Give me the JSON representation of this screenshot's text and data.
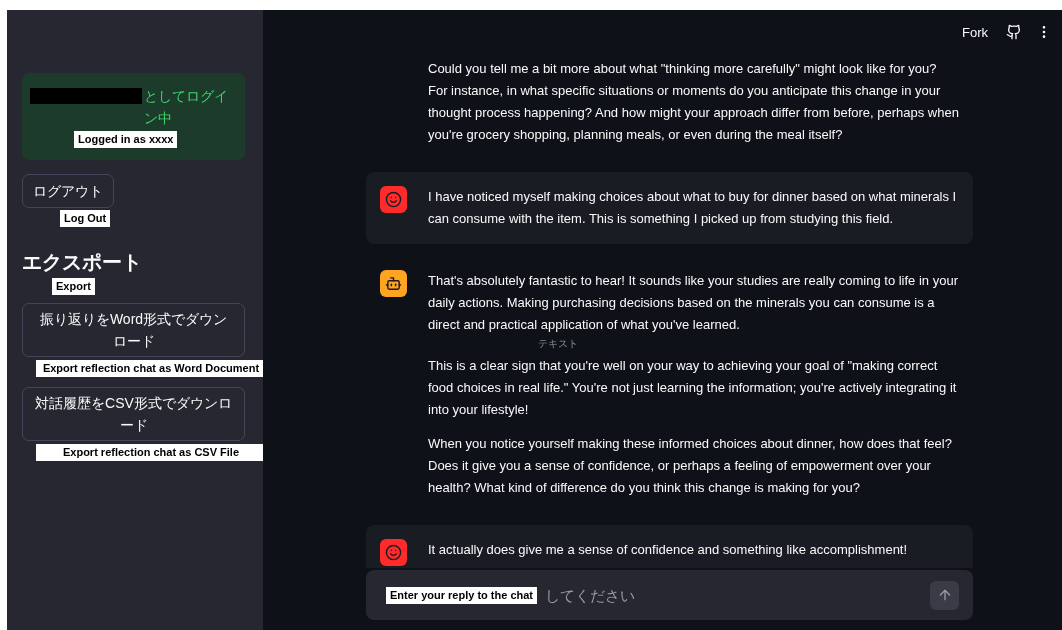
{
  "sidebar": {
    "login_status": {
      "text": "としてログイン中",
      "annotation": "Logged in as xxxx"
    },
    "logout_button": {
      "text": "ログアウト",
      "annotation": "Log Out"
    },
    "export_heading": {
      "text": "エクスポート",
      "annotation": "Export"
    },
    "export_buttons": [
      {
        "text": "振り返りをWord形式でダウンロード",
        "annotation": "Export reflection chat as Word Document"
      },
      {
        "text": "対話履歴をCSV形式でダウンロード",
        "annotation": "Export reflection chat as CSV File"
      }
    ]
  },
  "header": {
    "fork_label": "Fork"
  },
  "messages": [
    {
      "kind": "assistant",
      "avatar_visible": false,
      "paragraphs": [
        "Could you tell me a bit more about what \"thinking more carefully\" might look like for you? For instance, in what specific situations or moments do you anticipate this change in your thought process happening? And how might your approach differ from before, perhaps when you're grocery shopping, planning meals, or even during the meal itself?"
      ]
    },
    {
      "kind": "user",
      "avatar_visible": true,
      "paragraphs": [
        "I have noticed myself making choices about what to buy for dinner based on what minerals I can consume with the item. This is something I picked up from studying this field."
      ]
    },
    {
      "kind": "assistant",
      "avatar_visible": true,
      "note": "テキスト",
      "paragraphs": [
        "That's absolutely fantastic to hear! It sounds like your studies are really coming to life in your daily actions. Making purchasing decisions based on the minerals you can consume is a direct and practical application of what you've learned.",
        "This is a clear sign that you're well on your way to achieving your goal of \"making correct food choices in real life.\" You're not just learning the information; you're actively integrating it into your lifestyle!",
        "When you notice yourself making these informed choices about dinner, how does that feel? Does it give you a sense of confidence, or perhaps a feeling of empowerment over your health? What kind of difference do you think this change is making for you?"
      ]
    },
    {
      "kind": "user",
      "avatar_visible": true,
      "paragraphs": [
        "It actually does give me a sense of confidence and something like accomplishment!"
      ]
    }
  ],
  "chat_input": {
    "placeholder": "してください",
    "annotation": "Enter your reply to the chat"
  }
}
